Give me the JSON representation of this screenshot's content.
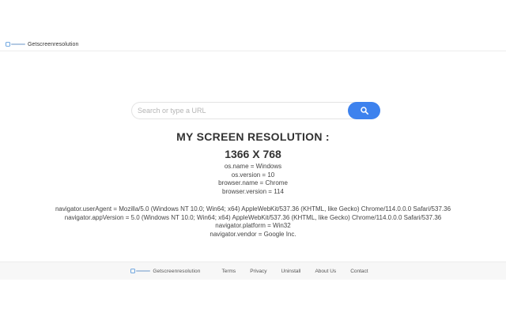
{
  "header": {
    "brand_name": "Getscreenresolution"
  },
  "search": {
    "placeholder": "Search or type a URL",
    "value": ""
  },
  "resolution": {
    "title": "MY SCREEN RESOLUTION :",
    "value": "1366 X 768"
  },
  "info_basic": [
    "os.name = Windows",
    "os.version = 10",
    "browser.name = Chrome",
    "browser.version = 114"
  ],
  "info_navigator": [
    "navigator.userAgent = Mozilla/5.0 (Windows NT 10.0; Win64; x64) AppleWebKit/537.36 (KHTML, like Gecko) Chrome/114.0.0.0 Safari/537.36",
    "navigator.appVersion = 5.0 (Windows NT 10.0; Win64; x64) AppleWebKit/537.36 (KHTML, like Gecko) Chrome/114.0.0.0 Safari/537.36",
    "navigator.platform = Win32",
    "navigator.vendor = Google Inc."
  ],
  "footer": {
    "brand_name": "Getscreenresolution",
    "links": [
      "Terms",
      "Privacy",
      "Uninstall",
      "About Us",
      "Contact"
    ]
  },
  "colors": {
    "accent": "#3d82ee",
    "footer_bg": "#f7f7f7",
    "text": "#333333"
  },
  "icons": {
    "search_button": "search-icon",
    "brand_logo": "logo-icon"
  }
}
